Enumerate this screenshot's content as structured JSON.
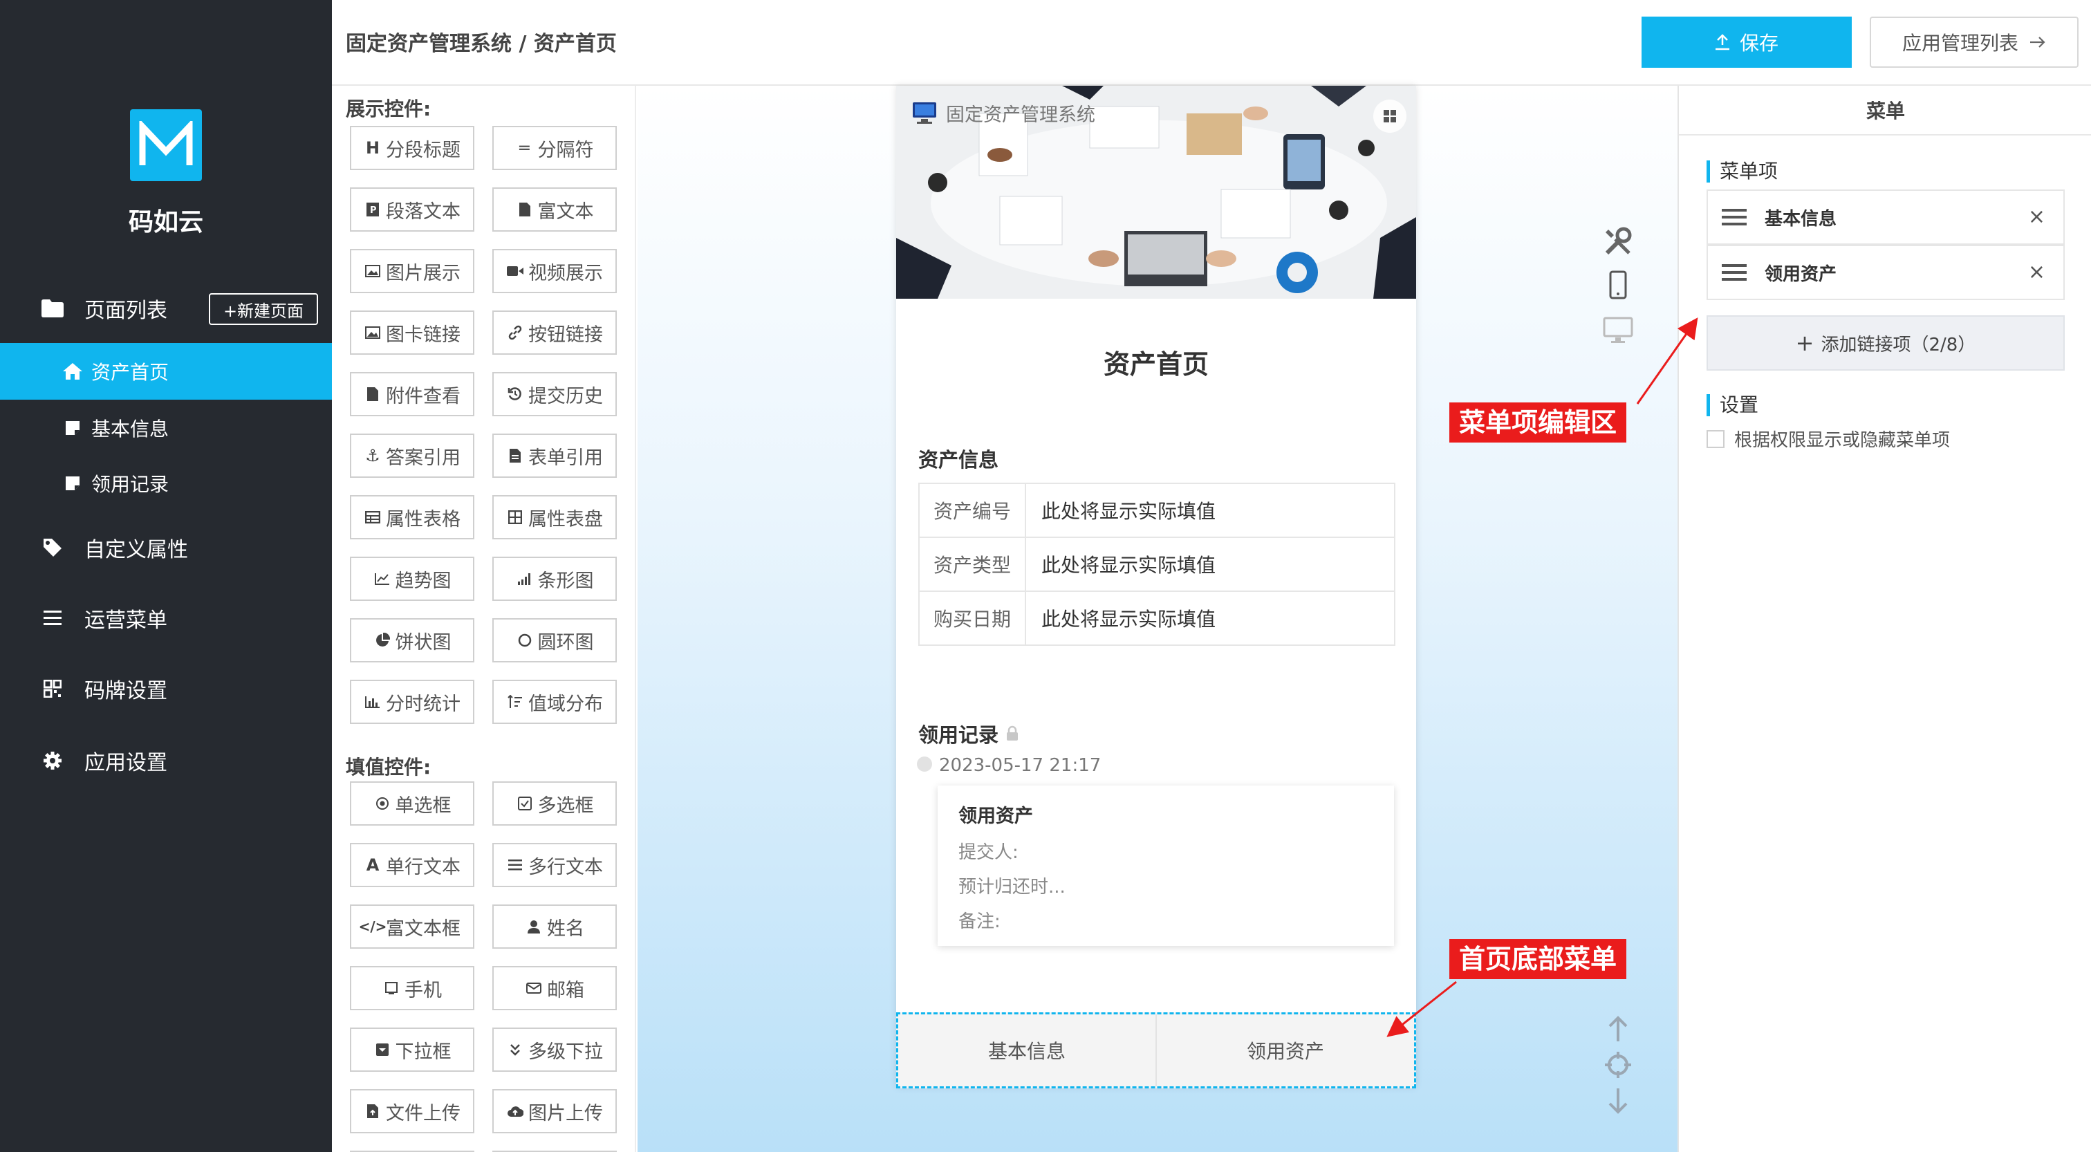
{
  "sidebar": {
    "brand": "码如云",
    "page_list_label": "页面列表",
    "new_page_label": "+新建页面",
    "pages": [
      {
        "label": "资产首页",
        "active": true
      },
      {
        "label": "基本信息",
        "active": false
      },
      {
        "label": "领用记录",
        "active": false
      }
    ],
    "items": [
      {
        "label": "自定义属性",
        "icon": "tag-icon"
      },
      {
        "label": "运营菜单",
        "icon": "list-icon"
      },
      {
        "label": "码牌设置",
        "icon": "qrcode-icon"
      },
      {
        "label": "应用设置",
        "icon": "gear-icon"
      }
    ]
  },
  "header": {
    "breadcrumb": "固定资产管理系统 / 资产首页",
    "save_label": "保存",
    "app_list_label": "应用管理列表"
  },
  "palette": {
    "display_title": "展示控件:",
    "display_widgets": [
      {
        "label": "分段标题",
        "icon": "heading-icon"
      },
      {
        "label": "分隔符",
        "icon": "divider-icon"
      },
      {
        "label": "段落文本",
        "icon": "paragraph-icon"
      },
      {
        "label": "富文本",
        "icon": "richtext-icon"
      },
      {
        "label": "图片展示",
        "icon": "image-icon"
      },
      {
        "label": "视频展示",
        "icon": "video-icon"
      },
      {
        "label": "图卡链接",
        "icon": "image-card-icon"
      },
      {
        "label": "按钮链接",
        "icon": "link-icon"
      },
      {
        "label": "附件查看",
        "icon": "attachment-icon"
      },
      {
        "label": "提交历史",
        "icon": "history-icon"
      },
      {
        "label": "答案引用",
        "icon": "anchor-icon"
      },
      {
        "label": "表单引用",
        "icon": "form-icon"
      },
      {
        "label": "属性表格",
        "icon": "table-icon"
      },
      {
        "label": "属性表盘",
        "icon": "grid-icon"
      },
      {
        "label": "趋势图",
        "icon": "trend-icon"
      },
      {
        "label": "条形图",
        "icon": "bar-chart-icon"
      },
      {
        "label": "饼状图",
        "icon": "pie-chart-icon"
      },
      {
        "label": "圆环图",
        "icon": "donut-icon"
      },
      {
        "label": "分时统计",
        "icon": "time-stats-icon"
      },
      {
        "label": "值域分布",
        "icon": "distribution-icon"
      }
    ],
    "input_title": "填值控件:",
    "input_widgets": [
      {
        "label": "单选框",
        "icon": "radio-icon"
      },
      {
        "label": "多选框",
        "icon": "checkbox-icon"
      },
      {
        "label": "单行文本",
        "icon": "text-icon"
      },
      {
        "label": "多行文本",
        "icon": "multiline-icon"
      },
      {
        "label": "富文本框",
        "icon": "code-icon"
      },
      {
        "label": "姓名",
        "icon": "user-icon"
      },
      {
        "label": "手机",
        "icon": "phone-icon"
      },
      {
        "label": "邮箱",
        "icon": "mail-icon"
      },
      {
        "label": "下拉框",
        "icon": "dropdown-icon"
      },
      {
        "label": "多级下拉",
        "icon": "cascade-icon"
      },
      {
        "label": "文件上传",
        "icon": "file-upload-icon"
      },
      {
        "label": "图片上传",
        "icon": "image-upload-icon"
      }
    ]
  },
  "preview": {
    "banner_title": "固定资产管理系统",
    "page_title": "资产首页",
    "asset_info_title": "资产信息",
    "asset_rows": [
      {
        "key": "资产编号",
        "value": "此处将显示实际填值"
      },
      {
        "key": "资产类型",
        "value": "此处将显示实际填值"
      },
      {
        "key": "购买日期",
        "value": "此处将显示实际填值"
      }
    ],
    "records_title": "领用记录",
    "record_time": "2023-05-17 21:17",
    "record_card": {
      "title": "领用资产",
      "lines": [
        "提交人:",
        "预计归还时...",
        "备注:"
      ]
    },
    "bottom_menu": [
      "基本信息",
      "领用资产"
    ]
  },
  "right_panel": {
    "title": "菜单",
    "menu_items_label": "菜单项",
    "menu_items": [
      "基本信息",
      "领用资产"
    ],
    "add_link_label": "添加链接项（2/8）",
    "settings_label": "设置",
    "permission_checkbox_label": "根据权限显示或隐藏菜单项",
    "permission_checked": false
  },
  "annotations": {
    "menu_edit_area": "菜单项编辑区",
    "home_bottom_menu": "首页底部菜单"
  },
  "colors": {
    "accent": "#10b5ee",
    "sidebar_bg": "#262a30",
    "annotation_red": "#ea1c1c"
  }
}
